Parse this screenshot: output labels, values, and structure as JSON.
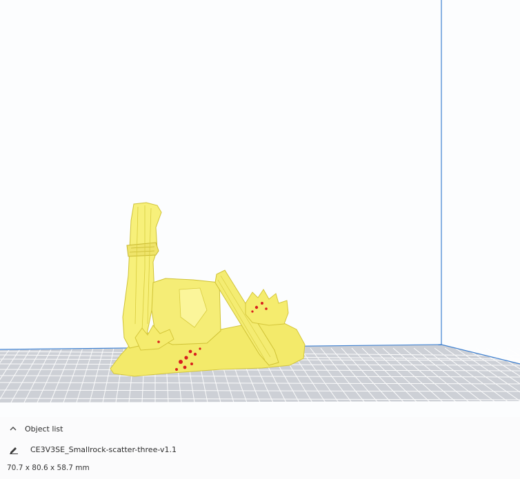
{
  "object_list": {
    "label": "Object list",
    "expanded": false
  },
  "object": {
    "name": "CE3V3SE_Smallrock-scatter-three-v1.1",
    "dimensions": "70.7 x 80.6 x 58.7 mm"
  },
  "colors": {
    "model": "#f7f07a",
    "model_shadow": "#d8cc3e",
    "model_highlight": "#fffbb0",
    "overhang": "#d81e1e",
    "build_plate": "#c9ccd2",
    "grid_line": "#ffffff",
    "volume_edge": "#3c7fd0",
    "viewport_bg": "#fcfdfe"
  },
  "icons": {
    "object_list_toggle": "chevron-up-icon",
    "edit_name": "pencil-icon"
  }
}
